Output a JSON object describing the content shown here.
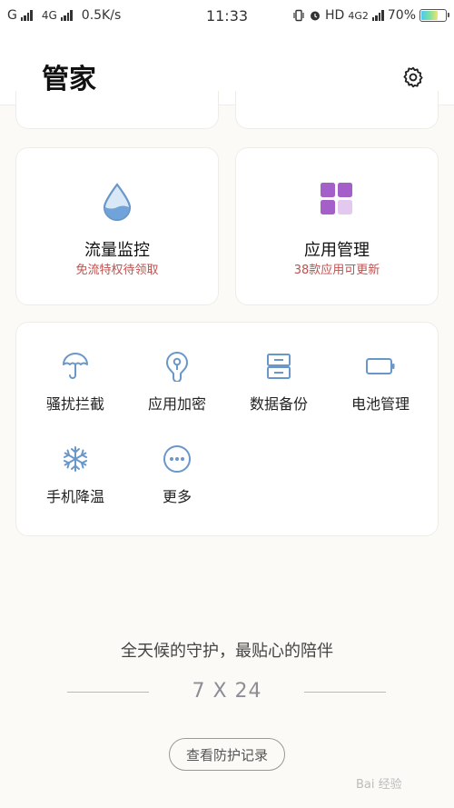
{
  "status_bar": {
    "carrier_left": "G",
    "network_type": "4G",
    "speed": "0.5K/s",
    "time": "11:33",
    "hd_label": "HD",
    "network_right": "4G",
    "sim_index": "2",
    "battery": "70%"
  },
  "header": {
    "title": "管家"
  },
  "feature_cards": [
    {
      "title": "流量监控",
      "subtitle": "免流特权待领取",
      "icon": "water-drop-icon"
    },
    {
      "title": "应用管理",
      "subtitle": "38款应用可更新",
      "icon": "app-grid-icon"
    }
  ],
  "tools": [
    {
      "label": "骚扰拦截",
      "icon": "umbrella-icon"
    },
    {
      "label": "应用加密",
      "icon": "lock-key-icon"
    },
    {
      "label": "数据备份",
      "icon": "storage-icon"
    },
    {
      "label": "电池管理",
      "icon": "battery-icon"
    },
    {
      "label": "手机降温",
      "icon": "snowflake-icon"
    },
    {
      "label": "更多",
      "icon": "more-icon"
    }
  ],
  "footer": {
    "tagline": "全天候的守护，最贴心的陪伴",
    "hours": "7 X 24",
    "records_button": "查看防护记录"
  },
  "watermark": "Bai 经验",
  "colors": {
    "accent_blue": "#6a97c9",
    "subtitle_red": "#c0504d",
    "app_purple": "#a45fc8",
    "background": "#fcfaf7"
  }
}
